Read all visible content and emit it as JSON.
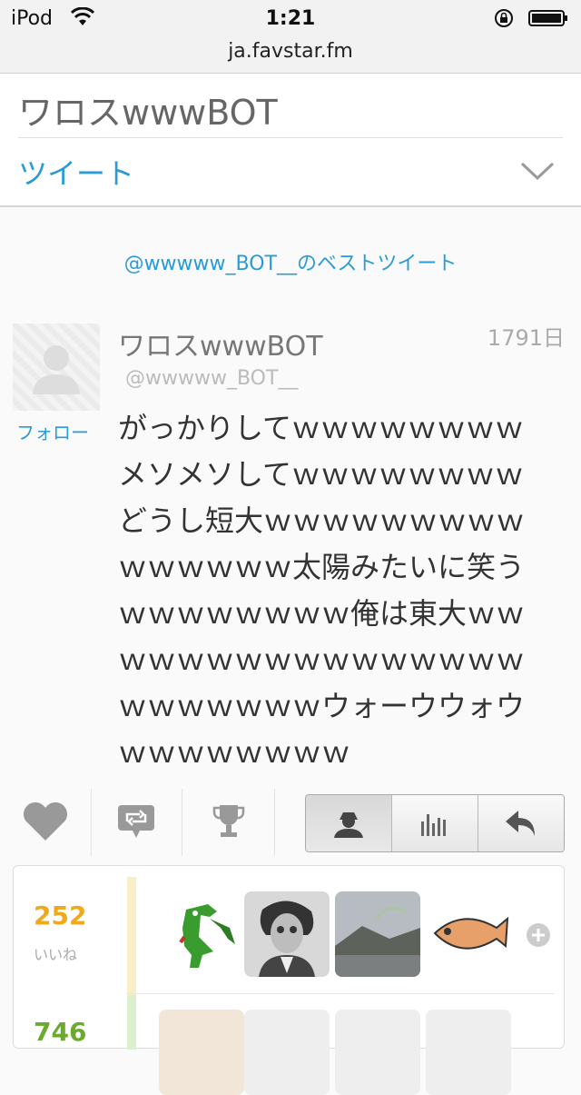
{
  "status_bar": {
    "carrier": "iPod",
    "time": "1:21"
  },
  "browser": {
    "url": "ja.favstar.fm"
  },
  "header": {
    "title": "ワロスwwwBOT",
    "nav_label": "ツイート"
  },
  "best_tweets_link": "@wwwww_BOT__のベストツイート",
  "tweet": {
    "author_name": "ワロスwwwBOT",
    "author_handle": "@wwwww_BOT__",
    "age": "1791日",
    "follow_label": "フォロー",
    "text": "がっかりしてｗｗｗｗｗｗｗｗメソメソしてｗｗｗｗｗｗｗｗどうし短大ｗｗｗｗｗｗｗｗｗｗｗｗｗｗｗ太陽みたいに笑うｗｗｗｗｗｗｗｗ俺は東大ｗｗｗｗｗｗｗｗｗｗｗｗｗｗｗｗｗｗｗｗｗｗｗウォーウウォウｗｗｗｗｗｗｗｗ"
  },
  "stats": [
    {
      "value": "252",
      "label": "いいね",
      "color": "#f0a81c"
    },
    {
      "value": "746",
      "label": "",
      "color": "#6aab2e"
    }
  ],
  "colors": {
    "link": "#2b9bd6",
    "icon_gray": "#999999"
  }
}
